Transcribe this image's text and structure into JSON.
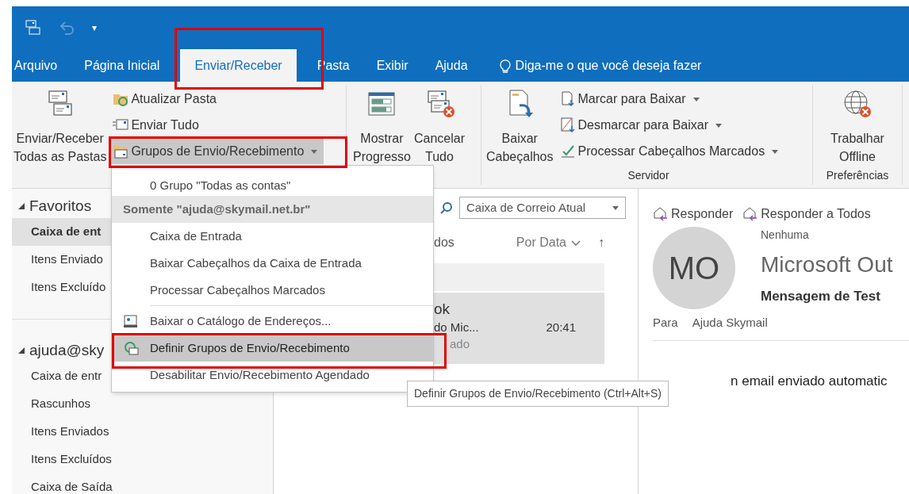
{
  "quick_access": {
    "more": "▾"
  },
  "tabs": [
    {
      "label": "Arquivo",
      "selected": false
    },
    {
      "label": "Página Inicial",
      "selected": false
    },
    {
      "label": "Enviar/Receber",
      "selected": true
    },
    {
      "label": "Pasta",
      "selected": false
    },
    {
      "label": "Exibir",
      "selected": false
    },
    {
      "label": "Ajuda",
      "selected": false
    }
  ],
  "tell_me": {
    "placeholder": "Diga-me o que você deseja fazer"
  },
  "ribbon": {
    "groups": [
      {
        "items": [
          {
            "kind": "large",
            "lines": [
              "Enviar/Receber",
              "Todas as Pastas"
            ]
          },
          {
            "kind": "stack",
            "buttons": [
              {
                "label": "Atualizar Pasta",
                "dropdown": false,
                "open": false
              },
              {
                "label": "Enviar Tudo",
                "dropdown": false,
                "open": false
              },
              {
                "label": "Grupos de Envio/Recebimento",
                "dropdown": true,
                "open": true
              }
            ]
          }
        ]
      },
      {
        "items": [
          {
            "kind": "large",
            "lines": [
              "Mostrar",
              "Progresso"
            ]
          },
          {
            "kind": "large",
            "lines": [
              "Cancelar",
              "Tudo"
            ]
          }
        ]
      },
      {
        "label": "Servidor",
        "items": [
          {
            "kind": "large",
            "lines": [
              "Baixar",
              "Cabeçalhos"
            ]
          },
          {
            "kind": "stack",
            "buttons": [
              {
                "label": "Marcar para Baixar",
                "dropdown": true,
                "open": false
              },
              {
                "label": "Desmarcar para Baixar",
                "dropdown": true,
                "open": false
              },
              {
                "label": "Processar Cabeçalhos Marcados",
                "dropdown": true,
                "open": false
              }
            ]
          }
        ]
      },
      {
        "label": "Preferências",
        "items": [
          {
            "kind": "large",
            "lines": [
              "Trabalhar",
              "Offline"
            ]
          }
        ]
      }
    ]
  },
  "folders": {
    "sections": [
      {
        "name": "Favoritos",
        "items": [
          {
            "label": "Caixa de ent",
            "selected": true
          },
          {
            "label": "Itens Enviado",
            "selected": false
          },
          {
            "label": "Itens Excluído",
            "selected": false
          }
        ]
      },
      {
        "name": "ajuda@sky",
        "items": [
          {
            "label": "Caixa de entr",
            "selected": false
          },
          {
            "label": "Rascunhos",
            "selected": false
          },
          {
            "label": "Itens Enviados",
            "selected": false
          },
          {
            "label": "Itens Excluídos",
            "selected": false
          },
          {
            "label": "Caixa de Saída",
            "selected": false
          }
        ]
      }
    ]
  },
  "message_list": {
    "scope": "Caixa de Correio Atual",
    "filter": "dos",
    "sort": "Por Data",
    "sort_direction": "↑",
    "messages": [
      {
        "sender": "ok",
        "subject": "do Mic...",
        "time": "20:41",
        "preview": "ado",
        "selected": true
      }
    ]
  },
  "reading_pane": {
    "actions": [
      "Responder",
      "Responder a Todos"
    ],
    "category": "Nenhuma",
    "avatar": "MO",
    "sender": "Microsoft Out",
    "subject": "Mensagem de Test",
    "to_label": "Para",
    "to": "Ajuda Skymail",
    "body": "n email enviado automatic"
  },
  "menu": {
    "items": [
      {
        "kind": "item",
        "label": "0 Grupo \"Todas as contas\"",
        "selected": false
      },
      {
        "kind": "header",
        "label": "Somente \"ajuda@skymail.net.br\""
      },
      {
        "kind": "item",
        "label": "Caixa de Entrada",
        "selected": false
      },
      {
        "kind": "item",
        "label": "Baixar Cabeçalhos da Caixa de Entrada",
        "selected": false
      },
      {
        "kind": "item",
        "label": "Processar Cabeçalhos Marcados",
        "selected": false
      },
      {
        "kind": "separator"
      },
      {
        "kind": "item",
        "label": "Baixar o Catálogo de Endereços...",
        "selected": false
      },
      {
        "kind": "item",
        "label": "Definir Grupos de Envio/Recebimento",
        "selected": true
      },
      {
        "kind": "item",
        "label": "Desabilitar Envio/Recebimento Agendado",
        "selected": false
      }
    ]
  },
  "tooltip": "Definir Grupos de Envio/Recebimento (Ctrl+Alt+S)"
}
